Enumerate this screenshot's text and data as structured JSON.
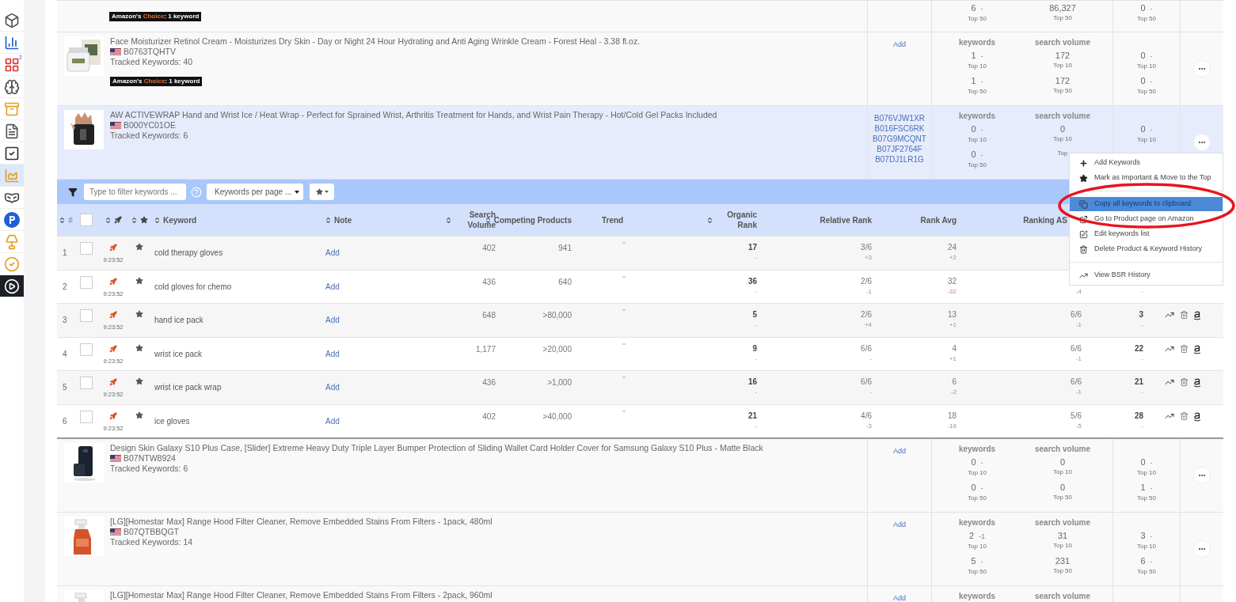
{
  "sidebar": {
    "items": [
      {
        "selected": false
      },
      {
        "selected": false
      },
      {
        "selected": false,
        "badge": "2"
      },
      {
        "selected": false
      },
      {
        "selected": false
      },
      {
        "selected": false
      },
      {
        "selected": false
      },
      {
        "selected": true
      },
      {
        "selected": false
      },
      {
        "selected": false
      },
      {
        "selected": false
      },
      {
        "selected": false
      },
      {
        "selected": false
      }
    ]
  },
  "products_before": [
    {
      "selected": false,
      "badge": {
        "prefix": "Amazon's ",
        "highlight": "Choice",
        "suffix": ": 1 keyword"
      },
      "metrics": {
        "kw": [
          {
            "value": "6",
            "change": "-",
            "label": "Top 50"
          }
        ],
        "sv": [
          {
            "value": "86,327",
            "label": "Top 50"
          }
        ],
        "third": [
          {
            "value": "0",
            "change": "-",
            "label": "Top 50"
          }
        ]
      }
    },
    {
      "selected": false,
      "title": "Face Moisturizer Retinol Cream - Moisturizes Dry Skin - Day or Night 24 Hour Hydrating and Anti Aging Wrinkle Cream - Forest Heal - 3.38 fl.oz.",
      "asin": "B0763TQHTV",
      "tracked": "Tracked Keywords: 40",
      "badge": {
        "prefix": "Amazon's ",
        "highlight": "Choice",
        "suffix": ": 1 keyword"
      },
      "add": "Add",
      "metrics": {
        "headers": [
          "keywords",
          "search volume"
        ],
        "kw": [
          {
            "value": "1",
            "change": "-",
            "label": "Top 10"
          },
          {
            "value": "1",
            "change": "-",
            "label": "Top 50"
          }
        ],
        "sv": [
          {
            "value": "172",
            "label": "Top 10"
          },
          {
            "value": "172",
            "label": "Top 50"
          }
        ],
        "third": [
          {
            "value": "0",
            "change": "-",
            "label": "Top 10"
          },
          {
            "value": "0",
            "change": "-",
            "label": "Top 50"
          }
        ]
      }
    },
    {
      "selected": true,
      "title": "AW ACTIVEWRAP Hand and Wrist Ice / Heat Wrap - Perfect for Sprained Wrist, Arthritis Treatment for Hands, and Wrist Pain Therapy - Hot/Cold Gel Packs Included",
      "asin": "B000YC01OE",
      "tracked": "Tracked Keywords: 6",
      "asins": [
        "B076VJW1XR",
        "B016FSC6RK",
        "B07G9MCQNT",
        "B07JF2764F",
        "B07DJ1LR1G"
      ],
      "metrics": {
        "headers": [
          "keywords",
          "search volume"
        ],
        "kw": [
          {
            "value": "0",
            "change": "-",
            "label": "Top 10"
          },
          {
            "value": "0",
            "change": "-",
            "label": "Top 50"
          }
        ],
        "sv": [
          {
            "value": "0",
            "label": "Top 10"
          },
          {
            "label": "Top"
          }
        ],
        "third": [
          {
            "value": "0",
            "change": "-",
            "label": "Top 10"
          }
        ]
      }
    }
  ],
  "keywords_panel": {
    "filter_placeholder": "Type to filter keywords ...",
    "per_page": "Keywords per page ...",
    "columns": [
      {
        "kind": "text",
        "label": "#",
        "sortable": true
      },
      {
        "kind": "checkbox",
        "checked": false
      },
      {
        "kind": "rocket",
        "sortable": true
      },
      {
        "kind": "star",
        "sortable": true
      },
      {
        "kind": "text",
        "label": "Keyword",
        "sortable": true
      },
      {
        "kind": "text",
        "label": "Note",
        "sortable": true
      },
      {
        "kind": "text",
        "label": "Search Volume",
        "sortable": true
      },
      {
        "kind": "text",
        "label": "Competing Products",
        "sortable": true
      },
      {
        "kind": "text",
        "label": "Trend",
        "sortable": false
      },
      {
        "kind": "text",
        "label": "Organic Rank",
        "sortable": true
      },
      {
        "kind": "text",
        "label": "Relative Rank",
        "sortable": false
      },
      {
        "kind": "text",
        "label": "Rank Avg",
        "sortable": false
      },
      {
        "kind": "text",
        "label": "Ranking AS",
        "sortable": false
      }
    ],
    "rows": [
      {
        "index": "1",
        "checked": false,
        "time": "9:23:52",
        "keyword": "cold therapy gloves",
        "note": "Add",
        "search_volume": "402",
        "competing": "941",
        "organic": {
          "value": "17",
          "change": "-"
        },
        "relative": {
          "value": "3/6",
          "change": "+3"
        },
        "rank_avg": {
          "value": "24",
          "change": "+2"
        }
      },
      {
        "index": "2",
        "checked": false,
        "time": "9:23:52",
        "keyword": "cold gloves for chemo",
        "note": "Add",
        "search_volume": "436",
        "competing": "640",
        "organic": {
          "value": "36",
          "change": "-"
        },
        "relative": {
          "value": "2/6",
          "change": "-1"
        },
        "rank_avg": {
          "value": "32",
          "change": "-32"
        },
        "ranking_asins": {
          "change": "-4"
        },
        "position": {
          "change": "-"
        }
      },
      {
        "index": "3",
        "checked": false,
        "time": "9:23:52",
        "keyword": "hand ice pack",
        "note": "Add",
        "search_volume": "648",
        "competing": ">80,000",
        "organic": {
          "value": "5",
          "change": "-"
        },
        "relative": {
          "value": "2/6",
          "change": "+4"
        },
        "rank_avg": {
          "value": "13",
          "change": "+1"
        },
        "ranking_asins": {
          "value": "6/6",
          "change": "-1"
        },
        "position": {
          "value": "3",
          "change": "-"
        }
      },
      {
        "index": "4",
        "checked": false,
        "time": "9:23:52",
        "keyword": "wrist ice pack",
        "note": "Add",
        "search_volume": "1,177",
        "competing": ">20,000",
        "organic": {
          "value": "9",
          "change": "-"
        },
        "relative": {
          "value": "6/6",
          "change": "-"
        },
        "rank_avg": {
          "value": "4",
          "change": "+1"
        },
        "ranking_asins": {
          "value": "6/6",
          "change": "-1"
        },
        "position": {
          "value": "22",
          "change": "-"
        }
      },
      {
        "index": "5",
        "checked": false,
        "time": "9:23:52",
        "keyword": "wrist ice pack wrap",
        "note": "Add",
        "search_volume": "436",
        "competing": ">1,000",
        "organic": {
          "value": "16",
          "change": "-"
        },
        "relative": {
          "value": "6/6",
          "change": "-"
        },
        "rank_avg": {
          "value": "6",
          "change": "-2"
        },
        "ranking_asins": {
          "value": "6/6",
          "change": "-1"
        },
        "position": {
          "value": "21",
          "change": "-"
        }
      },
      {
        "index": "6",
        "checked": false,
        "time": "9:23:52",
        "keyword": "ice gloves",
        "note": "Add",
        "search_volume": "402",
        "competing": ">40,000",
        "organic": {
          "value": "21",
          "change": "-"
        },
        "relative": {
          "value": "4/6",
          "change": "-3"
        },
        "rank_avg": {
          "value": "18",
          "change": "-18"
        },
        "ranking_asins": {
          "value": "5/6",
          "change": "-5"
        },
        "position": {
          "value": "28",
          "change": "-"
        }
      }
    ]
  },
  "products_after": [
    {
      "selected": false,
      "title": "Design Skin Galaxy S10 Plus Case, [Slider] Extreme Heavy Duty Triple Layer Bumper Protection of Sliding Wallet Card Holder Cover for Samsung Galaxy S10 Plus - Matte Black",
      "asin": "B07NTW8924",
      "tracked": "Tracked Keywords: 6",
      "add": "Add",
      "metrics": {
        "headers": [
          "keywords",
          "search volume"
        ],
        "kw": [
          {
            "value": "0",
            "change": "-",
            "label": "Top 10"
          },
          {
            "value": "0",
            "change": "-",
            "label": "Top 50"
          }
        ],
        "sv": [
          {
            "value": "0",
            "label": "Top 10"
          },
          {
            "value": "0",
            "label": "Top 50"
          }
        ],
        "third": [
          {
            "value": "0",
            "change": "-",
            "label": "Top 10"
          },
          {
            "value": "1",
            "change": "-",
            "label": "Top 50"
          }
        ]
      }
    },
    {
      "selected": false,
      "title": "[LG][Homestar Max] Range Hood Filter Cleaner, Remove Embedded Stains From Filters - 1pack, 480ml",
      "asin": "B07QTBBQGT",
      "tracked": "Tracked Keywords: 14",
      "add": "Add",
      "metrics": {
        "headers": [
          "keywords",
          "search volume"
        ],
        "kw": [
          {
            "value": "2",
            "change": "-1",
            "label": "Top 10"
          },
          {
            "value": "5",
            "change": "-",
            "label": "Top 50"
          }
        ],
        "sv": [
          {
            "value": "31",
            "label": "Top 10"
          },
          {
            "value": "231",
            "label": "Top 50"
          }
        ],
        "third": [
          {
            "value": "3",
            "change": "-",
            "label": "Top 10"
          },
          {
            "value": "6",
            "change": "-",
            "label": "Top 50"
          }
        ]
      }
    },
    {
      "selected": false,
      "title": "[LG][Homestar Max] Range Hood Filter Cleaner, Remove Embedded Stains From Filters - 2pack, 960ml",
      "add": "Add",
      "metrics": {
        "headers": [
          "keywords",
          "search volume"
        ]
      }
    }
  ],
  "menu": {
    "items": [
      {
        "kind": "item",
        "label": "Add Keywords",
        "selected": false
      },
      {
        "kind": "item",
        "label": "Mark as Important & Move to the Top",
        "selected": false
      },
      {
        "kind": "divider"
      },
      {
        "kind": "item",
        "label": "Copy all keywords to clipboard",
        "selected": true
      },
      {
        "kind": "item",
        "label": "Go to Product page on Amazon",
        "selected": false
      },
      {
        "kind": "item",
        "label": "Edit keywords list",
        "selected": false
      },
      {
        "kind": "item",
        "label": "Delete Product & Keyword History",
        "selected": false
      },
      {
        "kind": "divider"
      },
      {
        "kind": "item",
        "label": "View BSR History",
        "selected": false
      }
    ]
  }
}
